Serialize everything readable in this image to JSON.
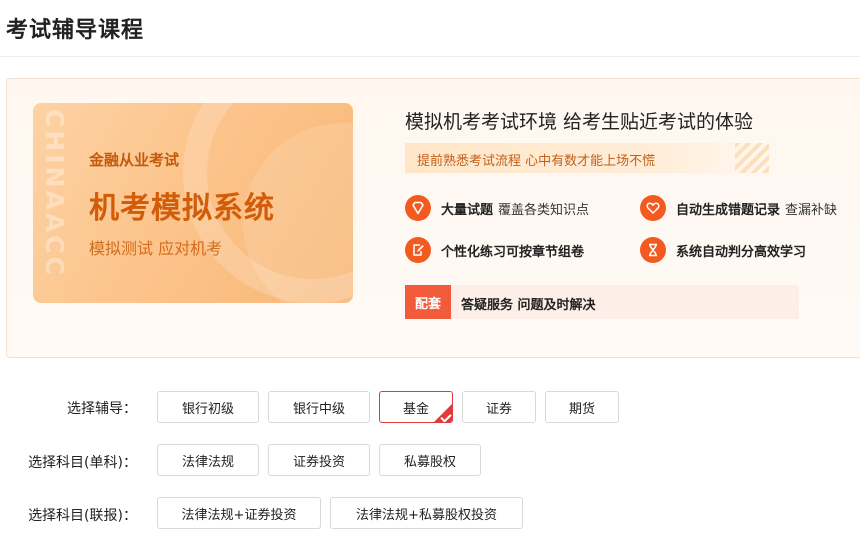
{
  "page": {
    "title": "考试辅导课程"
  },
  "banner": {
    "watermark": "CHINAACC",
    "sub_title": "金融从业考试",
    "main_title": "机考模拟系统",
    "slogan": "模拟测试 应对机考"
  },
  "promo": {
    "headline": "模拟机考考试环境 给考生贴近考试的体验",
    "tagline": "提前熟悉考试流程 心中有数才能上场不慌",
    "features": [
      {
        "icon": "diamond-icon",
        "bold": "大量试题",
        "light": "覆盖各类知识点"
      },
      {
        "icon": "heart-icon",
        "bold": "自动生成错题记录",
        "light": "查漏补缺"
      },
      {
        "icon": "edit-doc-icon",
        "bold": "个性化练习可按章节组卷",
        "light": ""
      },
      {
        "icon": "hourglass-icon",
        "bold": "系统自动判分高效学习",
        "light": ""
      }
    ],
    "bundle": {
      "badge": "配套",
      "text": "答疑服务 问题及时解决"
    }
  },
  "selectors": {
    "coaching": {
      "label": "选择辅导：",
      "options": [
        "银行初级",
        "银行中级",
        "基金",
        "证券",
        "期货"
      ],
      "selected": "基金"
    },
    "single": {
      "label": "选择科目(单科)：",
      "options": [
        "法律法规",
        "证券投资",
        "私募股权"
      ]
    },
    "combo": {
      "label": "选择科目(联报)：",
      "options": [
        "法律法规+证券投资",
        "法律法规+私募股权投资"
      ]
    }
  },
  "colors": {
    "accent": "#f35a20",
    "selected_border": "#e2393d",
    "banner_text": "#d25c08"
  }
}
